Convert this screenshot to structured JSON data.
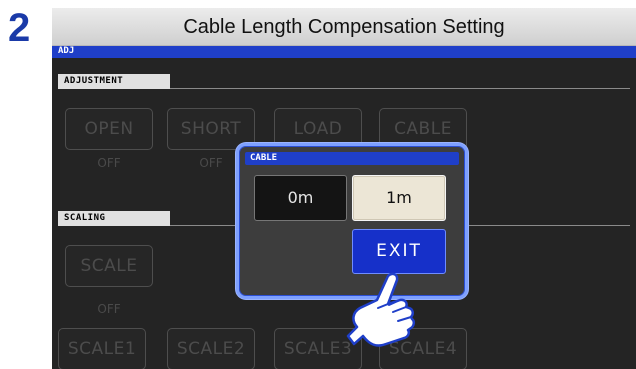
{
  "step": {
    "number": "2",
    "title": "Cable Length Compensation Setting"
  },
  "screen": {
    "header": "ADJ",
    "adjustment": {
      "label": "ADJUSTMENT",
      "buttons": [
        "OPEN",
        "SHORT",
        "LOAD",
        "CABLE"
      ],
      "states": [
        "OFF",
        "OFF"
      ]
    },
    "scaling": {
      "label": "SCALING",
      "scale_button": "SCALE",
      "scale_state": "OFF",
      "buttons": [
        "SCALE1",
        "SCALE2",
        "SCALE3",
        "SCALE4"
      ]
    }
  },
  "popup": {
    "title": "CABLE",
    "options": [
      "0m",
      "1m"
    ],
    "selected": "1m",
    "exit_label": "EXIT"
  },
  "colors": {
    "screen_bg": "#242424",
    "header_blue": "#1f3fc9",
    "popup_border": "#7ea0ff",
    "exit_button": "#1630c9",
    "selected_option": "#ece6d6",
    "step_number": "#1a3aa8"
  },
  "icons": {
    "pointer": "pointing-hand-icon"
  }
}
